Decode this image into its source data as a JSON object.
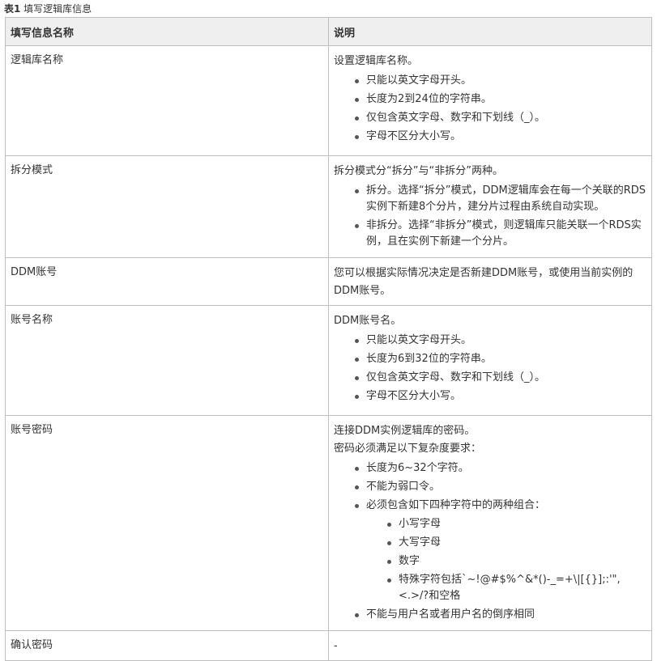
{
  "caption": {
    "label": "表1",
    "text": " 填写逻辑库信息"
  },
  "header": {
    "col1": "填写信息名称",
    "col2": "说明"
  },
  "rows": [
    {
      "name": "逻辑库名称",
      "intro": "设置逻辑库名称。",
      "bullets": [
        "只能以英文字母开头。",
        "长度为2到24位的字符串。",
        "仅包含英文字母、数字和下划线（_）。",
        "字母不区分大小写。"
      ]
    },
    {
      "name": "拆分模式",
      "intro": "拆分模式分“拆分”与“非拆分”两种。",
      "bullets": [
        "拆分。选择“拆分”模式，DDM逻辑库会在每一个关联的RDS实例下新建8个分片，建分片过程由系统自动实现。",
        "非拆分。选择“非拆分”模式，则逻辑库只能关联一个RDS实例，且在实例下新建一个分片。"
      ]
    },
    {
      "name": "DDM账号",
      "intro": "您可以根据实际情况决定是否新建DDM账号，或使用当前实例的DDM账号。"
    },
    {
      "name": "账号名称",
      "intro": "DDM账号名。",
      "bullets": [
        "只能以英文字母开头。",
        "长度为6到32位的字符串。",
        "仅包含英文字母、数字和下划线（_）。",
        "字母不区分大小写。"
      ]
    },
    {
      "name": "账号密码",
      "intro": "连接DDM实例逻辑库的密码。",
      "intro2": "密码必须满足以下复杂度要求：",
      "bullets": [
        "长度为6~32个字符。",
        "不能为弱口令。",
        "必须包含如下四种字符中的两种组合："
      ],
      "sub_bullets": [
        "小写字母",
        "大写字母",
        "数字",
        "特殊字符包括`~!@#$%^&*()-_=+\\|[{}];:'\",<.>/?和空格"
      ],
      "last_bullet": "不能与用户名或者用户名的倒序相同"
    },
    {
      "name": "确认密码",
      "intro": "-"
    }
  ]
}
